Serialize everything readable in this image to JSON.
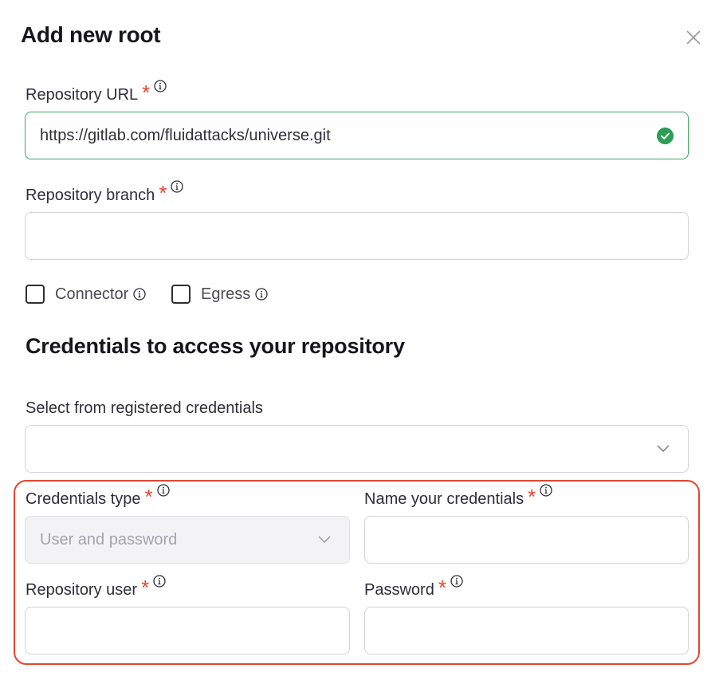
{
  "modal": {
    "title": "Add new root"
  },
  "repository_url": {
    "label": "Repository URL",
    "required_mark": "*",
    "value": "https://gitlab.com/fluidattacks/universe.git",
    "status": "valid"
  },
  "repository_branch": {
    "label": "Repository branch",
    "required_mark": "*",
    "value": ""
  },
  "options": {
    "connector_label": "Connector",
    "connector_checked": false,
    "egress_label": "Egress",
    "egress_checked": false
  },
  "credentials": {
    "section_title": "Credentials to access your repository",
    "registered_label": "Select from registered credentials",
    "registered_value": "",
    "type_label": "Credentials type",
    "type_required_mark": "*",
    "type_value": "User and password",
    "name_label": "Name your credentials",
    "name_required_mark": "*",
    "name_value": "",
    "user_label": "Repository user",
    "user_required_mark": "*",
    "user_value": "",
    "password_label": "Password",
    "password_required_mark": "*",
    "password_value": ""
  },
  "colors": {
    "required": "#e5452f",
    "valid": "#2d9e55",
    "highlight_border": "#e5452f"
  }
}
